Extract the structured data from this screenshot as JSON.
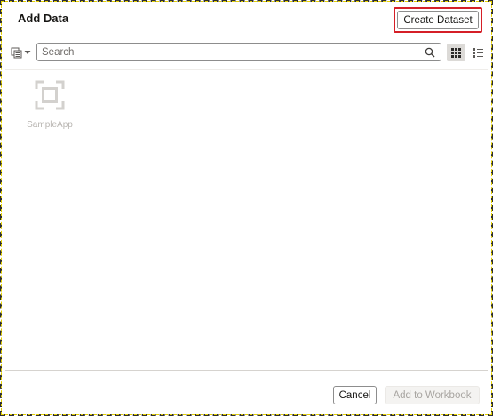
{
  "dialog": {
    "title": "Add Data",
    "create_dataset_label": "Create Dataset"
  },
  "toolbar": {
    "source_picker_icon": "database-stack-icon",
    "dropdown_icon": "caret-down-icon",
    "search_placeholder": "Search",
    "search_value": "",
    "search_icon": "search-icon",
    "grid_view_icon": "grid-view-icon",
    "list_view_icon": "list-view-icon",
    "active_view": "grid"
  },
  "items": [
    {
      "label": "SampleApp",
      "icon": "subject-area-icon"
    }
  ],
  "footer": {
    "cancel_label": "Cancel",
    "add_label": "Add to Workbook",
    "add_enabled": false
  },
  "colors": {
    "highlight_border": "#d51f27",
    "text": "#161513",
    "muted_text": "#b9b6b2",
    "disabled_text": "#a8a5a1",
    "active_view_bg": "#dcdad7"
  }
}
